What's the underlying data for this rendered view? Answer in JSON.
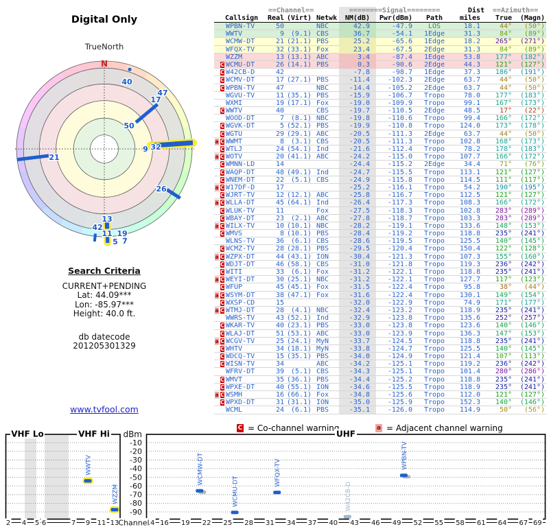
{
  "radar": {
    "title": "Digital Only",
    "subtitle": "TrueNorth",
    "north_label": "N",
    "bars": [
      {
        "az": 50,
        "r0": 0.47,
        "r1": 0.79,
        "w": 5,
        "halo": false
      },
      {
        "az": 86,
        "r0": 0.53,
        "r1": 1.01,
        "w": 7,
        "halo": true
      },
      {
        "az": 263,
        "r0": 0.63,
        "r1": 1.0,
        "w": 5,
        "halo": false
      },
      {
        "az": 123,
        "r0": 0.85,
        "r1": 1.03,
        "w": 5,
        "halo": false
      },
      {
        "az": 178,
        "r0": 0.82,
        "r1": 0.91,
        "w": 6,
        "halo": true
      },
      {
        "az": 186,
        "r0": 0.97,
        "r1": 1.06,
        "w": 4,
        "halo": false
      },
      {
        "az": 178,
        "r0": 1.0,
        "r1": 1.07,
        "w": 5,
        "halo": true
      },
      {
        "az": 167,
        "r0": 1.0,
        "r1": 1.06,
        "w": 3,
        "halo": false
      }
    ],
    "dot": {
      "az": 17.7,
      "r": 0.95
    },
    "labels": [
      [
        "40",
        33,
        -98
      ],
      [
        "47",
        85,
        -82
      ],
      [
        "17",
        75,
        -72
      ],
      [
        "50",
        36,
        -34
      ],
      [
        "9",
        60,
        0
      ],
      [
        "32",
        75,
        -3
      ],
      [
        "21",
        -73,
        12
      ],
      [
        "26",
        83,
        58
      ],
      [
        "13",
        4,
        102
      ],
      [
        "42",
        -10,
        114
      ],
      [
        "11",
        4,
        123
      ],
      [
        "19",
        26,
        123
      ],
      [
        "5",
        16,
        135
      ],
      [
        "7",
        30,
        134
      ]
    ]
  },
  "search": {
    "heading": "Search Criteria",
    "mode": "CURRENT+PENDING",
    "lat": "Lat: 44.09***",
    "lon": "Lon: -85.97***",
    "height": "Height: 40.0 ft.",
    "datecode_label": "db datecode",
    "datecode": "201205301329",
    "link": "www.tvfool.com"
  },
  "table": {
    "groups": {
      "channel": "==Channel==",
      "signal": "========Signal========",
      "dist": "Dist",
      "azimuth": "==Azimuth=="
    },
    "columns": {
      "callsign": "Callsign",
      "real": "Real",
      "virt": "(Virt)",
      "netwk": "Netwk",
      "nm": "NM(dB)",
      "pwr": "Pwr(dBm)",
      "path": "Path",
      "miles": "miles",
      "true": "True",
      "magn": "(Magn)"
    },
    "rows": [
      [
        "",
        "WPBN-TV",
        "50",
        "",
        "NBC",
        "42.9",
        "-47.9",
        "LOS",
        "18.1",
        "44°",
        "(50°)"
      ],
      [
        "",
        "WWTV",
        "9",
        "(9.1)",
        "CBS",
        "36.7",
        "-54.1",
        "1Edge",
        "31.3",
        "84°",
        "(89°)"
      ],
      [
        "",
        "WCMW-DT",
        "21",
        "(21.1)",
        "PBS",
        "25.2",
        "-65.6",
        "1Edge",
        "18.2",
        "265°",
        "(271°)"
      ],
      [
        "",
        "WFQX-TV",
        "32",
        "(33.1)",
        "Fox",
        "23.4",
        "-67.5",
        "2Edge",
        "31.3",
        "84°",
        "(89°)"
      ],
      [
        "",
        "WZZM",
        "13",
        "(13.1)",
        "ABC",
        "3.4",
        "-87.4",
        "1Edge",
        "53.8",
        "177°",
        "(182°)"
      ],
      [
        "C",
        "WCMU-DT",
        "26",
        "(14.1)",
        "PBS",
        "0.3",
        "-90.6",
        "2Edge",
        "44.3",
        "121°",
        "(127°)"
      ],
      [
        "C",
        "W42CB-D",
        "42",
        "",
        "",
        "-7.8",
        "-98.7",
        "1Edge",
        "37.3",
        "186°",
        "(191°)"
      ],
      [
        "C",
        "WCMV-DT",
        "17",
        "(27.1)",
        "PBS",
        "-11.4",
        "-102.3",
        "2Edge",
        "63.7",
        "44°",
        "(50°)"
      ],
      [
        "C",
        "WPBN-TV",
        "47",
        "",
        "NBC",
        "-14.4",
        "-105.2",
        "2Edge",
        "63.7",
        "44°",
        "(50°)"
      ],
      [
        "",
        "WGVU-TV",
        "11",
        "(35.1)",
        "PBS",
        "-15.9",
        "-106.7",
        "Tropo",
        "78.0",
        "177°",
        "(183°)"
      ],
      [
        "",
        "WXMI",
        "19",
        "(17.1)",
        "Fox",
        "-19.0",
        "-109.9",
        "Tropo",
        "99.1",
        "167°",
        "(173°)"
      ],
      [
        "C",
        "WWTV",
        "40",
        "",
        "CBS",
        "-19.7",
        "-110.5",
        "2Edge",
        "48.5",
        "17°",
        "(22°)"
      ],
      [
        "",
        "WOOD-DT",
        "7",
        "(8.1)",
        "NBC",
        "-19.8",
        "-110.6",
        "Tropo",
        "99.4",
        "166°",
        "(172°)"
      ],
      [
        "C",
        "WGVK-DT",
        "5",
        "(52.1)",
        "PBS",
        "-19.9",
        "-110.8",
        "Tropo",
        "124.0",
        "173°",
        "(178°)"
      ],
      [
        "C",
        "WGTU",
        "29",
        "(29.1)",
        "ABC",
        "-20.5",
        "-111.3",
        "2Edge",
        "63.7",
        "44°",
        "(50°)"
      ],
      [
        "aC",
        "WWMT",
        "8",
        "(3.1)",
        "CBS",
        "-20.5",
        "-111.3",
        "Tropo",
        "102.8",
        "168°",
        "(173°)"
      ],
      [
        "C",
        "WTLJ",
        "24",
        "(54.1)",
        "Ind",
        "-21.6",
        "-112.4",
        "Tropo",
        "78.2",
        "178°",
        "(183°)"
      ],
      [
        "aC",
        "WOTV",
        "20",
        "(41.1)",
        "ABC",
        "-24.2",
        "-115.0",
        "Tropo",
        "107.7",
        "166°",
        "(172°)"
      ],
      [
        "C",
        "WMNN-LD",
        "14",
        "",
        "",
        "-24.4",
        "-115.2",
        "2Edge",
        "34.4",
        "71°",
        "(76°)"
      ],
      [
        "C",
        "WAQP-DT",
        "48",
        "(49.1)",
        "Ind",
        "-24.7",
        "-115.5",
        "Tropo",
        "113.1",
        "121°",
        "(127°)"
      ],
      [
        "C",
        "WNEM-DT",
        "22",
        "(5.1)",
        "CBS",
        "-24.9",
        "-115.8",
        "Tropo",
        "114.5",
        "111°",
        "(117°)"
      ],
      [
        "aC",
        "W17DF-D",
        "17",
        "",
        "",
        "-25.2",
        "-116.1",
        "Tropo",
        "54.2",
        "190°",
        "(195°)"
      ],
      [
        "C",
        "WJRT-TV",
        "12",
        "(12.1)",
        "ABC",
        "-25.8",
        "-116.7",
        "Tropo",
        "112.5",
        "121°",
        "(127°)"
      ],
      [
        "aC",
        "WLLA-DT",
        "45",
        "(64.1)",
        "Ind",
        "-26.4",
        "-117.3",
        "Tropo",
        "108.3",
        "166°",
        "(172°)"
      ],
      [
        "C",
        "WLUK-TV",
        "11",
        "",
        "Fox",
        "-27.5",
        "-118.3",
        "Tropo",
        "102.8",
        "283°",
        "(289°)"
      ],
      [
        "C",
        "WBAY-DT",
        "23",
        "(2.1)",
        "ABC",
        "-27.8",
        "-118.7",
        "Tropo",
        "103.3",
        "283°",
        "(289°)"
      ],
      [
        "aC",
        "WILX-TV",
        "10",
        "(10.1)",
        "NBC",
        "-28.2",
        "-119.1",
        "Tropo",
        "133.6",
        "148°",
        "(153°)"
      ],
      [
        "C",
        "WMVS",
        "8",
        "(10.1)",
        "PBS",
        "-28.4",
        "-119.2",
        "Tropo",
        "118.8",
        "235°",
        "(241°)"
      ],
      [
        "",
        "WLNS-TV",
        "36",
        "(6.1)",
        "CBS",
        "-28.6",
        "-119.5",
        "Tropo",
        "125.5",
        "140°",
        "(145°)"
      ],
      [
        "C",
        "WCMZ-TV",
        "28",
        "(28.1)",
        "PBS",
        "-29.5",
        "-120.4",
        "Tropo",
        "150.4",
        "122°",
        "(128°)"
      ],
      [
        "aC",
        "WZPX-DT",
        "44",
        "(43.1)",
        "ION",
        "-30.4",
        "-121.3",
        "Tropo",
        "107.3",
        "155°",
        "(160°)"
      ],
      [
        "C",
        "WDJT-DT",
        "46",
        "(58.1)",
        "CBS",
        "-31.0",
        "-121.8",
        "Tropo",
        "119.3",
        "236°",
        "(242°)"
      ],
      [
        "C",
        "WITI",
        "33",
        "(6.1)",
        "Fox",
        "-31.2",
        "-122.1",
        "Tropo",
        "118.8",
        "235°",
        "(241°)"
      ],
      [
        "aC",
        "WEYI-DT",
        "30",
        "(25.1)",
        "NBC",
        "-31.2",
        "-122.1",
        "Tropo",
        "127.7",
        "117°",
        "(123°)"
      ],
      [
        "C",
        "WFUP",
        "45",
        "(45.1)",
        "Fox",
        "-31.5",
        "-122.4",
        "Tropo",
        "95.8",
        "38°",
        "(44°)"
      ],
      [
        "aC",
        "WSYM-DT",
        "38",
        "(47.1)",
        "Fox",
        "-31.6",
        "-122.4",
        "Tropo",
        "130.1",
        "149°",
        "(154°)"
      ],
      [
        "C",
        "WXSP-CD",
        "15",
        "",
        "",
        "-32.0",
        "-122.9",
        "Tropo",
        "74.9",
        "171°",
        "(177°)"
      ],
      [
        "aC",
        "WTMJ-DT",
        "28",
        "(4.1)",
        "NBC",
        "-32.4",
        "-123.2",
        "Tropo",
        "118.9",
        "235°",
        "(241°)"
      ],
      [
        "",
        "WWRS-TV",
        "43",
        "(52.1)",
        "Ind",
        "-32.9",
        "-123.8",
        "Tropo",
        "135.6",
        "252°",
        "(257°)"
      ],
      [
        "C",
        "WKAR-TV",
        "40",
        "(23.1)",
        "PBS",
        "-33.0",
        "-123.8",
        "Tropo",
        "123.6",
        "140°",
        "(146°)"
      ],
      [
        "C",
        "WLAJ-DT",
        "51",
        "(53.1)",
        "ABC",
        "-33.0",
        "-123.9",
        "Tropo",
        "136.3",
        "147°",
        "(153°)"
      ],
      [
        "aC",
        "WCGV-TV",
        "25",
        "(24.1)",
        "MyN",
        "-33.7",
        "-124.5",
        "Tropo",
        "118.8",
        "235°",
        "(241°)"
      ],
      [
        "C",
        "WHTV",
        "34",
        "(18.1)",
        "MyN",
        "-33.8",
        "-124.7",
        "Tropo",
        "125.5",
        "140°",
        "(145°)"
      ],
      [
        "C",
        "WDCQ-TV",
        "15",
        "(35.1)",
        "PBS",
        "-34.0",
        "-124.9",
        "Tropo",
        "121.4",
        "107°",
        "(113°)"
      ],
      [
        "C",
        "WISN-TV",
        "34",
        "",
        "ABC",
        "-34.2",
        "-125.1",
        "Tropo",
        "119.2",
        "236°",
        "(242°)"
      ],
      [
        "",
        "WFRV-DT",
        "39",
        "(5.1)",
        "CBS",
        "-34.3",
        "-125.1",
        "Tropo",
        "101.4",
        "280°",
        "(286°)"
      ],
      [
        "C",
        "WMVT",
        "35",
        "(36.1)",
        "PBS",
        "-34.4",
        "-125.2",
        "Tropo",
        "118.8",
        "235°",
        "(241°)"
      ],
      [
        "C",
        "WPXE-DT",
        "40",
        "(55.1)",
        "ION",
        "-34.6",
        "-125.5",
        "Tropo",
        "118.9",
        "235°",
        "(241°)"
      ],
      [
        "aC",
        "WSMH",
        "16",
        "(66.1)",
        "Fox",
        "-34.8",
        "-125.6",
        "Tropo",
        "112.0",
        "121°",
        "(127°)"
      ],
      [
        "C",
        "WPXD-DT",
        "31",
        "(31.1)",
        "ION",
        "-35.0",
        "-125.9",
        "Tropo",
        "152.3",
        "140°",
        "(146°)"
      ],
      [
        "",
        "WCML",
        "24",
        "(6.1)",
        "PBS",
        "-35.1",
        "-126.0",
        "Tropo",
        "114.9",
        "50°",
        "(56°)"
      ]
    ]
  },
  "legend": {
    "c_symbol": "C",
    "c_text": "= Co-channel warning",
    "a_symbol": "a",
    "a_text": "= Adjacent channel warning"
  },
  "spectrum": {
    "axis_label": "dBm",
    "channel_label": "Channel",
    "sections": [
      "VHF Lo",
      "VHF Hi",
      "UHF"
    ],
    "dbm_ticks": [
      -10,
      -20,
      -30,
      -40,
      -50,
      -60,
      -70,
      -80,
      -90
    ],
    "vhf_ticks": [
      2,
      4,
      5,
      6,
      7,
      9,
      11,
      13
    ],
    "uhf_ticks": [
      14,
      16,
      19,
      22,
      25,
      28,
      31,
      34,
      37,
      40,
      43,
      46,
      49,
      52,
      55,
      58,
      61,
      64,
      67,
      69
    ],
    "signals": [
      {
        "callsign": "WWTV",
        "channel": 9,
        "dbm": -54.1,
        "band": "vhf",
        "halo": true,
        "shadow": false,
        "muted": false
      },
      {
        "callsign": "WZZM",
        "channel": 13,
        "dbm": -87.4,
        "band": "vhf",
        "halo": true,
        "shadow": false,
        "muted": false
      },
      {
        "callsign": "WCMW-DT",
        "channel": 21,
        "dbm": -65.6,
        "band": "uhf",
        "halo": false,
        "shadow": true,
        "muted": false
      },
      {
        "callsign": "WCMU-DT",
        "channel": 26,
        "dbm": -90.6,
        "band": "uhf",
        "halo": false,
        "shadow": false,
        "muted": false
      },
      {
        "callsign": "WFQX-TV",
        "channel": 32,
        "dbm": -67.5,
        "band": "uhf",
        "halo": false,
        "shadow": false,
        "muted": false
      },
      {
        "callsign": "W42CB-D",
        "channel": 42,
        "dbm": -98.7,
        "band": "uhf",
        "halo": false,
        "shadow": false,
        "muted": true
      },
      {
        "callsign": "WPBN-TV",
        "channel": 50,
        "dbm": -47.9,
        "band": "uhf",
        "halo": false,
        "shadow": true,
        "muted": false
      }
    ]
  },
  "chart_data": [
    {
      "type": "scatter",
      "variant": "polar-azimuth",
      "title": "Digital Only",
      "orientation_label": "TrueNorth",
      "points": [
        {
          "channel": 40,
          "az_true": 17
        },
        {
          "channel": 47,
          "az_true": 44
        },
        {
          "channel": 17,
          "az_true": 44
        },
        {
          "channel": 50,
          "az_true": 44
        },
        {
          "channel": 9,
          "az_true": 84
        },
        {
          "channel": 32,
          "az_true": 84
        },
        {
          "channel": 21,
          "az_true": 265
        },
        {
          "channel": 26,
          "az_true": 121
        },
        {
          "channel": 13,
          "az_true": 177
        },
        {
          "channel": 42,
          "az_true": 186
        },
        {
          "channel": 11,
          "az_true": 177
        },
        {
          "channel": 19,
          "az_true": 167
        },
        {
          "channel": 5,
          "az_true": 173
        },
        {
          "channel": 7,
          "az_true": 166
        }
      ]
    },
    {
      "type": "bar",
      "title": "Signal power by RF channel",
      "xlabel": "Channel",
      "ylabel": "dBm",
      "ylim": [
        -95,
        -5
      ],
      "sections": [
        "VHF Lo",
        "VHF Hi",
        "UHF"
      ],
      "points": [
        {
          "callsign": "WWTV",
          "channel": 9,
          "dbm": -54.1
        },
        {
          "callsign": "WZZM",
          "channel": 13,
          "dbm": -87.4
        },
        {
          "callsign": "WCMW-DT",
          "channel": 21,
          "dbm": -65.6
        },
        {
          "callsign": "WCMU-DT",
          "channel": 26,
          "dbm": -90.6
        },
        {
          "callsign": "WFQX-TV",
          "channel": 32,
          "dbm": -67.5
        },
        {
          "callsign": "W42CB-D",
          "channel": 42,
          "dbm": -98.7
        },
        {
          "callsign": "WPBN-TV",
          "channel": 50,
          "dbm": -47.9
        }
      ]
    }
  ]
}
